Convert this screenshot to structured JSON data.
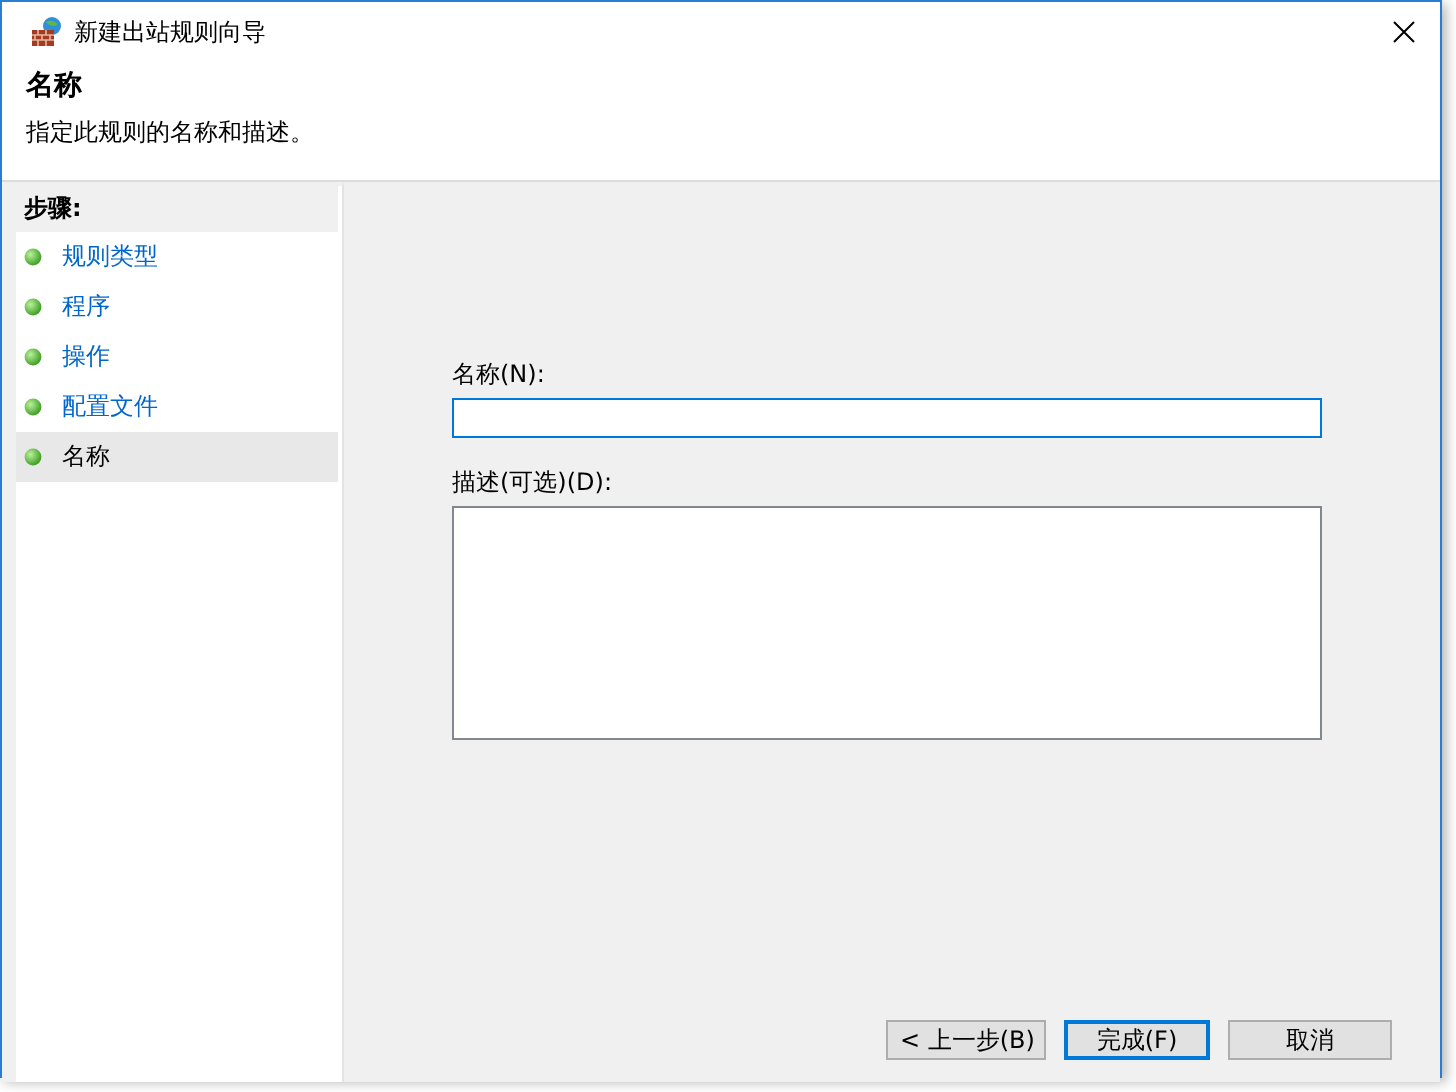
{
  "window": {
    "title": "新建出站规则向导"
  },
  "header": {
    "title": "名称",
    "subtitle": "指定此规则的名称和描述。"
  },
  "steps": {
    "heading": "步骤:",
    "items": [
      {
        "label": "规则类型",
        "selected": false
      },
      {
        "label": "程序",
        "selected": false
      },
      {
        "label": "操作",
        "selected": false
      },
      {
        "label": "配置文件",
        "selected": false
      },
      {
        "label": "名称",
        "selected": true
      }
    ]
  },
  "form": {
    "name_label": "名称(N):",
    "name_focused": true,
    "description_label": "描述(可选)(D):"
  },
  "buttons": [
    {
      "label": "< 上一步(B)",
      "default": false
    },
    {
      "label": "完成(F)",
      "default": true
    },
    {
      "label": "取消",
      "default": false
    }
  ]
}
